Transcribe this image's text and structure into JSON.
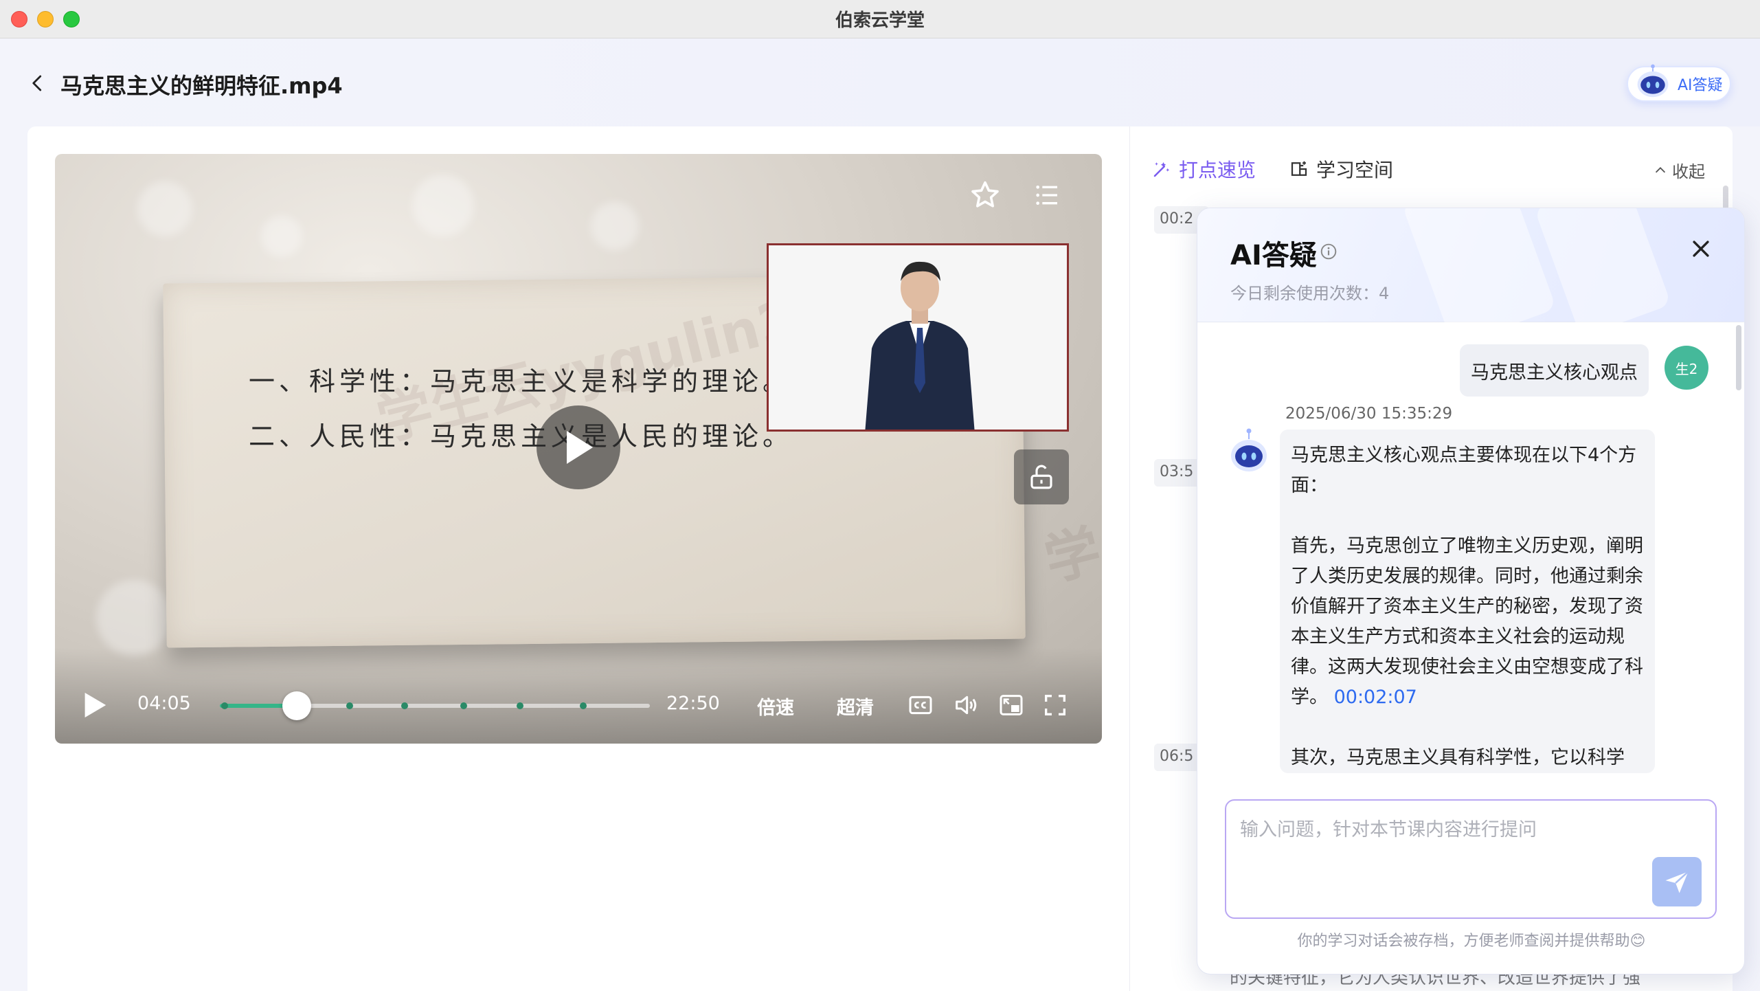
{
  "window": {
    "title": "伯索云学堂"
  },
  "header": {
    "title": "马克思主义的鲜明特征.mp4",
    "ai_button": "AI答疑"
  },
  "video": {
    "slide_line1": "一、科学性：马克思主义是科学的理论。",
    "slide_line2": "二、人民性：马克思主义是人民的理论。",
    "watermark1": "学生云yygulin2",
    "watermark2": "学",
    "current_time": "04:05",
    "total_time": "22:50",
    "progress": 0.179,
    "speed_label": "倍速",
    "quality_label": "超清"
  },
  "panel": {
    "tabs": [
      {
        "label": "打点速览",
        "active": true
      },
      {
        "label": "学习空间",
        "active": false
      }
    ],
    "collapse_label": "收起",
    "timestamps": [
      "00:2",
      "03:5",
      "06:5"
    ],
    "bg_text": "的关键特征，它为人类认识世界、改造世界提供了强"
  },
  "ai_dialog": {
    "title": "AI答疑",
    "remaining": "今日剩余使用次数：4",
    "user_question": "马克思主义核心观点",
    "user_avatar": "生2",
    "timestamp": "2025/06/30 15:35:29",
    "answer_p1": "马克思主义核心观点主要体现在以下4个方面：",
    "answer_p2": "首先，马克思创立了唯物主义历史观，阐明了人类历史发展的规律。同时，他通过剩余价值解开了资本主义生产的秘密，发现了资本主义生产方式和资本主义社会的运动规律。这两大发现使社会主义由空想变成了科学。",
    "answer_p2_link": "00:02:07",
    "answer_p3": "其次，马克思主义具有科学性，它以科学",
    "input_placeholder": "输入问题，针对本节课内容进行提问",
    "footer": "你的学习对话会被存档，方便老师查阅并提供帮助😊"
  },
  "colors": {
    "accent": "#7a5cf0",
    "progress": "#35b588",
    "link": "#2d6af0"
  }
}
